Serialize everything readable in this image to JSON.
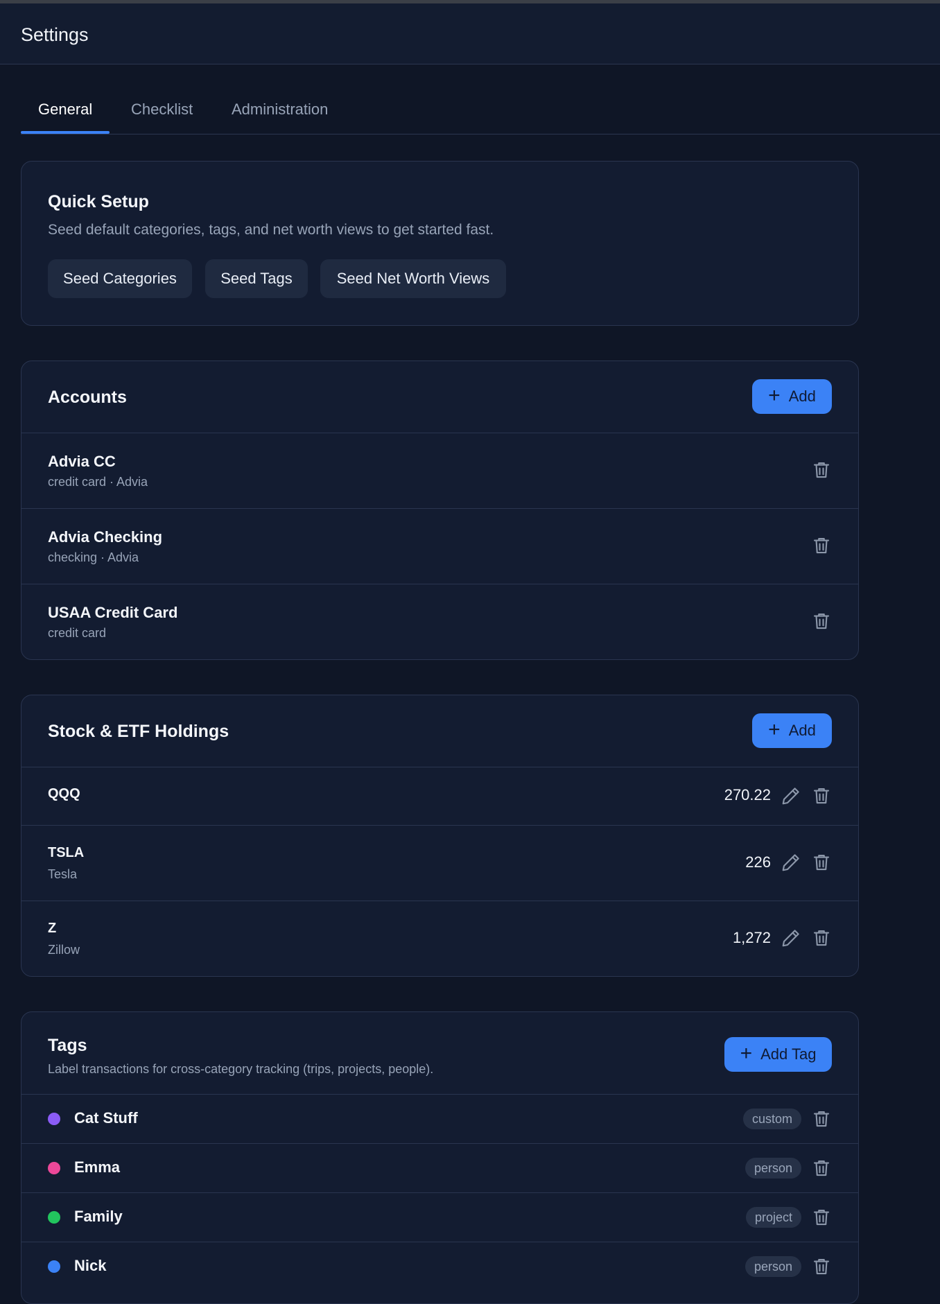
{
  "header": {
    "title": "Settings"
  },
  "tabs": [
    {
      "label": "General",
      "active": true
    },
    {
      "label": "Checklist",
      "active": false
    },
    {
      "label": "Administration",
      "active": false
    }
  ],
  "quick_setup": {
    "title": "Quick Setup",
    "description": "Seed default categories, tags, and net worth views to get started fast.",
    "buttons": [
      "Seed Categories",
      "Seed Tags",
      "Seed Net Worth Views"
    ]
  },
  "accounts": {
    "title": "Accounts",
    "add_label": "Add",
    "items": [
      {
        "name": "Advia CC",
        "meta": "credit card · Advia"
      },
      {
        "name": "Advia Checking",
        "meta": "checking · Advia"
      },
      {
        "name": "USAA Credit Card",
        "meta": "credit card"
      }
    ]
  },
  "holdings": {
    "title": "Stock & ETF Holdings",
    "add_label": "Add",
    "items": [
      {
        "symbol": "QQQ",
        "name": "",
        "value": "270.22"
      },
      {
        "symbol": "TSLA",
        "name": "Tesla",
        "value": "226"
      },
      {
        "symbol": "Z",
        "name": "Zillow",
        "value": "1,272"
      }
    ]
  },
  "tags": {
    "title": "Tags",
    "description": "Label transactions for cross-category tracking (trips, projects, people).",
    "add_label": "Add Tag",
    "items": [
      {
        "name": "Cat Stuff",
        "type": "custom",
        "color": "#8b5cf6"
      },
      {
        "name": "Emma",
        "type": "person",
        "color": "#ec4899"
      },
      {
        "name": "Family",
        "type": "project",
        "color": "#22c55e"
      },
      {
        "name": "Nick",
        "type": "person",
        "color": "#3b82f6"
      }
    ]
  },
  "colors": {
    "accent": "#3b82f6",
    "background": "#0f1626",
    "card": "#131c31"
  }
}
